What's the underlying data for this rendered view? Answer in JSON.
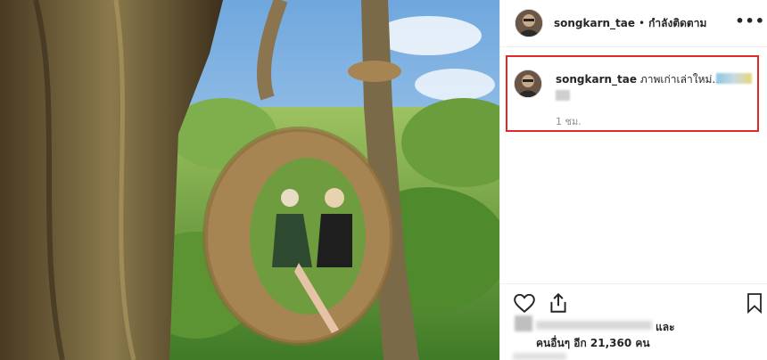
{
  "post": {
    "username": "songkarn_tae",
    "separator": "•",
    "follow_status": "กำลังติดตาม",
    "more_icon": "more-options-icon",
    "caption": {
      "username": "songkarn_tae",
      "text": "ภาพเก่าเล่าใหม่...",
      "time": "1 ชม."
    },
    "actions": {
      "like_icon": "heart-icon",
      "share_icon": "share-icon",
      "save_icon": "bookmark-icon"
    },
    "likes": {
      "and_text": "และ",
      "others_text": "คนอื่นๆ อีก 21,360 คน"
    },
    "colors": {
      "highlight_border": "#e0292b",
      "text": "#262626",
      "muted": "#8e8e8e"
    }
  }
}
